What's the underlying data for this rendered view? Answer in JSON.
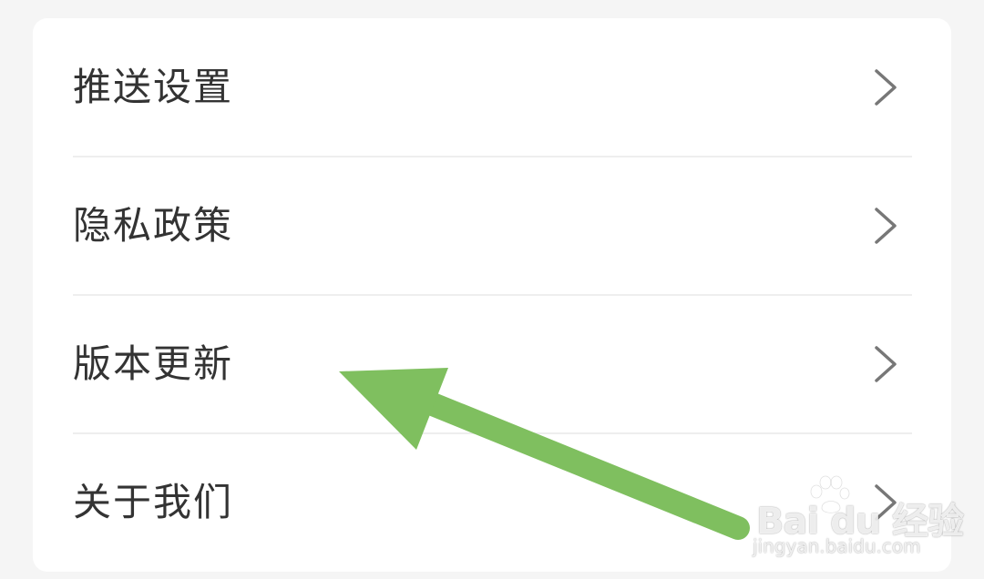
{
  "settings": {
    "items": [
      {
        "label": "推送设置"
      },
      {
        "label": "隐私政策"
      },
      {
        "label": "版本更新"
      },
      {
        "label": "关于我们"
      }
    ]
  },
  "annotation": {
    "color": "#7fbf5f"
  },
  "watermark": {
    "brand": "Bai du 经验",
    "url": "jingyan.baidu.com"
  }
}
